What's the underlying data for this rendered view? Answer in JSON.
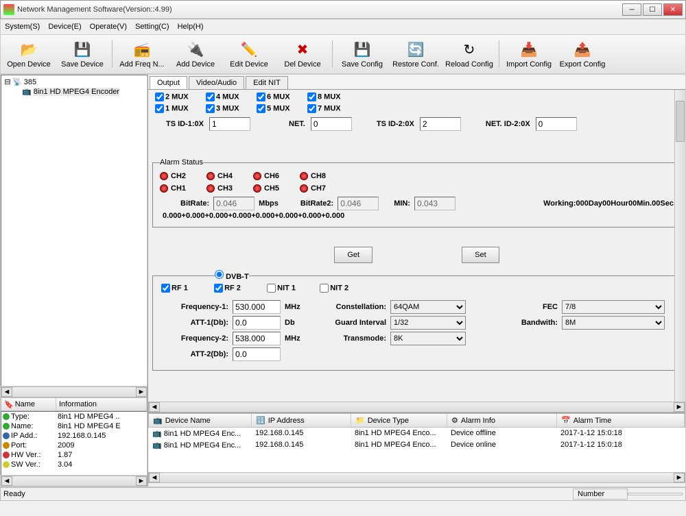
{
  "window": {
    "title": "Network Management Software(Version::4.99)"
  },
  "menu": {
    "system": "System(S)",
    "device": "Device(E)",
    "operate": "Operate(V)",
    "setting": "Setting(C)",
    "help": "Help(H)"
  },
  "toolbar": {
    "open": "Open Device",
    "save": "Save Device",
    "addfreq": "Add Freq N...",
    "adddev": "Add Device",
    "edit": "Edit Device",
    "del": "Del Device",
    "savecfg": "Save Config",
    "restore": "Restore Conf.",
    "reload": "Reload Config",
    "import": "Import Config",
    "export": "Export Config"
  },
  "tree": {
    "root": "385",
    "child": "8in1 HD MPEG4 Encoder"
  },
  "info_hdr": {
    "name": "Name",
    "information": "Information"
  },
  "info": [
    {
      "k": "Type:",
      "v": "8in1 HD MPEG4 ..",
      "c": "#3a3"
    },
    {
      "k": "Name:",
      "v": "8in1 HD MPEG4 E",
      "c": "#3a3"
    },
    {
      "k": "IP Add.:",
      "v": "192.168.0.145",
      "c": "#36a"
    },
    {
      "k": "Port:",
      "v": "2009",
      "c": "#c80"
    },
    {
      "k": "HW Ver.:",
      "v": "1.87",
      "c": "#c33"
    },
    {
      "k": "SW Ver.:",
      "v": "3.04",
      "c": "#cc3"
    }
  ],
  "tabs": {
    "output": "Output",
    "va": "Video/Audio",
    "nit": "Edit NIT"
  },
  "mux": {
    "r1": [
      "2 MUX",
      "4 MUX",
      "6 MUX",
      "8 MUX"
    ],
    "r2": [
      "1 MUX",
      "3 MUX",
      "5 MUX",
      "7 MUX"
    ]
  },
  "ts": {
    "id1lbl": "TS ID-1:0X",
    "id1": "1",
    "netlbl": "NET.",
    "net": "0",
    "id2lbl": "TS ID-2:0X",
    "id2": "2",
    "net2lbl": "NET. ID-2:0X",
    "net2": "0"
  },
  "alarm": {
    "legend": "Alarm Status",
    "row1": [
      "CH2",
      "CH4",
      "CH6",
      "CH8"
    ],
    "row2": [
      "CH1",
      "CH3",
      "CH5",
      "CH7"
    ],
    "brlbl": "BitRate:",
    "br": "0.046",
    "mbps": "Mbps",
    "br2lbl": "BitRate2:",
    "br2": "0.046",
    "minlbl": "MIN:",
    "min": "0.043",
    "working": "Working:000Day00Hour00Min.00Sec",
    "sum": "0.000+0.000+0.000+0.000+0.000+0.000+0.000+0.000"
  },
  "btns": {
    "get": "Get",
    "set": "Set"
  },
  "dvbt": {
    "radio": "DVB-T",
    "rf1": "RF 1",
    "rf2": "RF 2",
    "nit1": "NIT 1",
    "nit2": "NIT 2",
    "f1lbl": "Frequency-1:",
    "f1": "530.000",
    "mhz": "MHz",
    "att1lbl": "ATT-1(Db):",
    "att1": "0.0",
    "db": "Db",
    "f2lbl": "Frequency-2:",
    "f2": "538.000",
    "att2lbl": "ATT-2(Db):",
    "att2": "0.0",
    "constlbl": "Constellation:",
    "const": "64QAM",
    "gilbl": "Guard Interval",
    "gi": "1/32",
    "tmlbl": "Transmode:",
    "tm": "8K",
    "feclbl": "FEC",
    "fec": "7/8",
    "bwlbl": "Bandwith:",
    "bw": "8M"
  },
  "grid": {
    "hdrs": {
      "name": "Device Name",
      "ip": "IP Address",
      "type": "Device Type",
      "alarm": "Alarm Info",
      "time": "Alarm Time"
    },
    "rows": [
      {
        "name": "8in1 HD MPEG4 Enc...",
        "ip": "192.168.0.145",
        "type": "8in1 HD MPEG4 Enco...",
        "alarm": "Device offline",
        "time": "2017-1-12 15:0:18"
      },
      {
        "name": "8in1 HD MPEG4 Enc...",
        "ip": "192.168.0.145",
        "type": "8in1 HD MPEG4 Enco...",
        "alarm": "Device online",
        "time": "2017-1-12 15:0:18"
      }
    ]
  },
  "status": {
    "ready": "Ready",
    "number": "Number"
  }
}
